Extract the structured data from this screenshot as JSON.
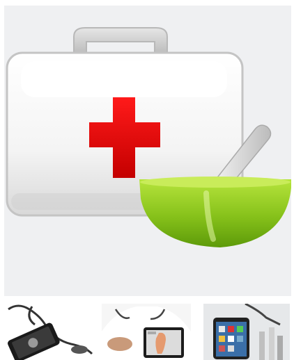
{
  "gallery": {
    "main_image": {
      "icon": "first-aid-kit-with-mortar-and-pestle"
    },
    "thumbnails": [
      {
        "icon": "smartphone-with-stethoscope"
      },
      {
        "icon": "doctor-holding-tablet"
      },
      {
        "icon": "smartphone-with-medical-apps"
      }
    ]
  },
  "colors": {
    "hero_background": "#eff0f2",
    "cross_red": "#e00000",
    "mortar_green": "#8cc61a"
  }
}
